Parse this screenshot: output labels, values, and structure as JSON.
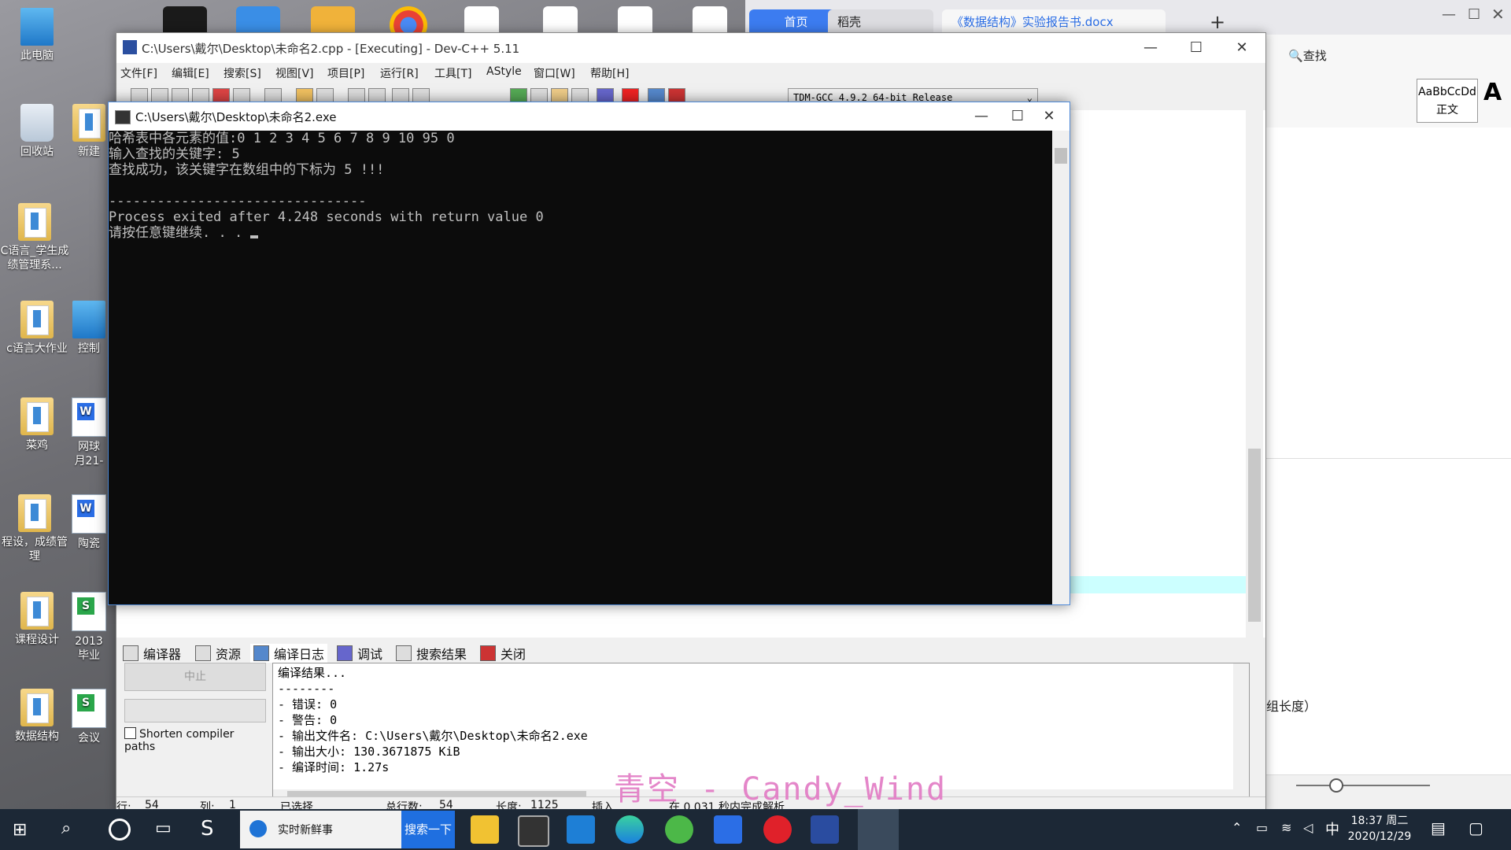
{
  "desktop": {
    "icons": [
      {
        "label": "此电脑"
      },
      {
        "label": "回收站"
      },
      {
        "label": "C语言_学生成绩管理系..."
      },
      {
        "label": "c语言大作业"
      },
      {
        "label": "菜鸡"
      },
      {
        "label": "程设，成绩管理"
      },
      {
        "label": "课程设计"
      },
      {
        "label": "数据结构"
      }
    ],
    "col2": [
      {
        "label": "新建"
      },
      {
        "label": "控制"
      },
      {
        "label": "网球 月21-"
      },
      {
        "label": "陶瓷"
      },
      {
        "label": "2013 毕业"
      },
      {
        "label": "会议"
      }
    ]
  },
  "wps": {
    "tabs": [
      {
        "label": "首页"
      },
      {
        "label": "稻壳"
      },
      {
        "label": "《数据结构》实验报告书.docx"
      }
    ],
    "search_label": "查找",
    "style_preview": "AaBbCcDd",
    "style_name": "正文",
    "doc_text": "组长度）"
  },
  "devcpp": {
    "title": "C:\\Users\\戴尔\\Desktop\\未命名2.cpp - [Executing] - Dev-C++ 5.11",
    "menu": [
      "文件[F]",
      "编辑[E]",
      "搜索[S]",
      "视图[V]",
      "项目[P]",
      "运行[R]",
      "工具[T]",
      "AStyle",
      "窗口[W]",
      "帮助[H]"
    ],
    "compiler": "TDM-GCC 4.9.2 64-bit Release",
    "panel_tabs": [
      "编译器",
      "资源",
      "编译日志",
      "调试",
      "搜索结果",
      "关闭"
    ],
    "abort_label": "中止",
    "shorten_label": "Shorten compiler paths",
    "log": "编译结果...\n--------\n- 错误: 0\n- 警告: 0\n- 输出文件名: C:\\Users\\戴尔\\Desktop\\未命名2.exe\n- 输出大小: 130.3671875 KiB\n- 编译时间: 1.27s",
    "status": {
      "row_label": "行:",
      "row": "54",
      "col_label": "列:",
      "col": "1",
      "selected_label": "已选择",
      "total_label": "总行数:",
      "total": "54",
      "length_label": "长度:",
      "length": "1125",
      "mode": "插入",
      "parse": "在 0.031 秒内完成解析"
    }
  },
  "console": {
    "title": "C:\\Users\\戴尔\\Desktop\\未命名2.exe",
    "output": "哈希表中各元素的值:0 1 2 3 4 5 6 7 8 9 10 95 0\n输入查找的关键字: 5\n查找成功，该关键字在数组中的下标为 5 !!!\n\n--------------------------------\nProcess exited after 4.248 seconds with return value 0\n请按任意键继续. . . "
  },
  "taskbar": {
    "search_text": "实时新鲜事",
    "search_button": "搜索一下",
    "ime": "中",
    "time": "18:37 周二",
    "date": "2020/12/29"
  },
  "watermark": "青空 - Candy_Wind"
}
